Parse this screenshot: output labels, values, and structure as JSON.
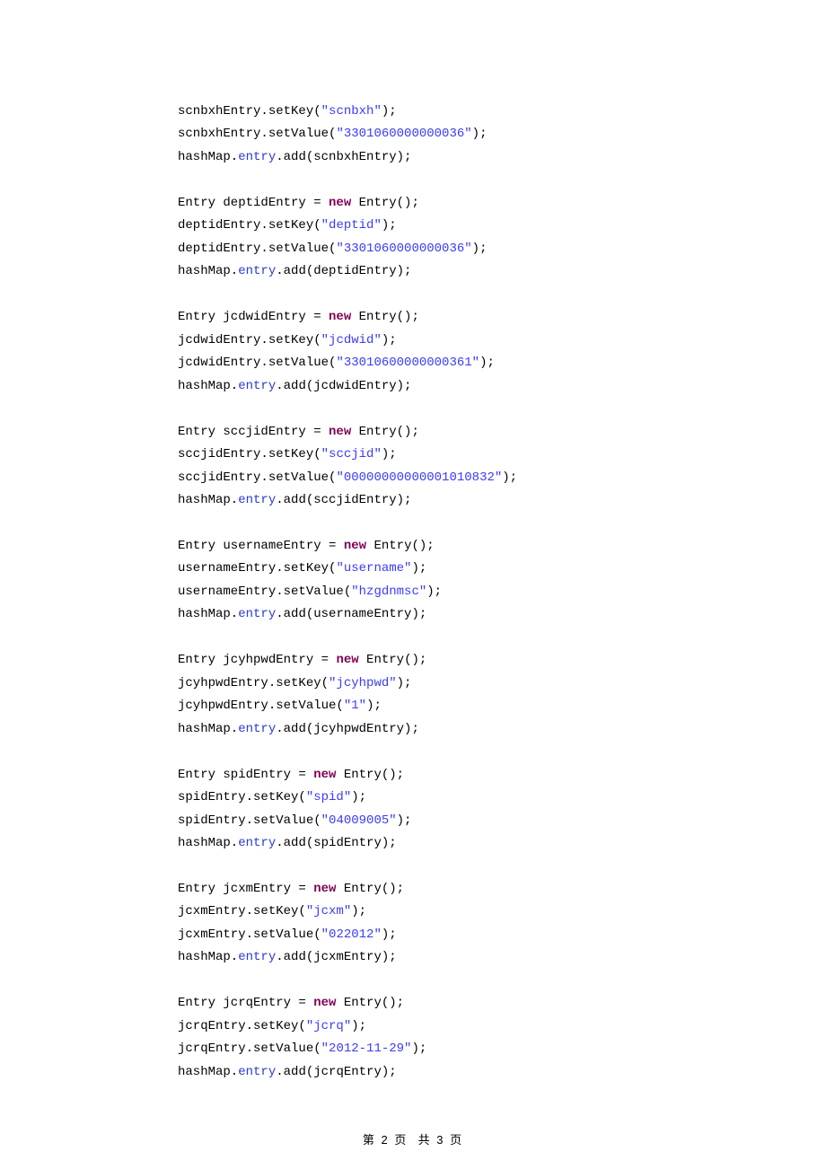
{
  "code": {
    "entries": [
      {
        "var": "scnbxhEntry",
        "key": "scnbxh",
        "value": "3301060000000036"
      },
      {
        "var": "deptidEntry",
        "key": "deptid",
        "value": "3301060000000036"
      },
      {
        "var": "jcdwidEntry",
        "key": "jcdwid",
        "value": "33010600000000361"
      },
      {
        "var": "sccjidEntry",
        "key": "sccjid",
        "value": "00000000000001010832"
      },
      {
        "var": "usernameEntry",
        "key": "username",
        "value": "hzgdnmsc"
      },
      {
        "var": "jcyhpwdEntry",
        "key": "jcyhpwd",
        "value": "1"
      },
      {
        "var": "spidEntry",
        "key": "spid",
        "value": "04009005"
      },
      {
        "var": "jcxmEntry",
        "key": "jcxm",
        "value": "022012"
      },
      {
        "var": "jcrqEntry",
        "key": "jcrq",
        "value": "2012-11-29"
      }
    ],
    "first_no_decl": true,
    "keyword_new": "new",
    "type_name": "Entry",
    "method_setKey": ".setKey(",
    "method_setValue": ".setValue(",
    "close_call": ");",
    "hashmap_prefix": "hashMap.",
    "entry_field": "entry",
    "add_open": ".add(",
    "decl_prefix": "Entry ",
    "equals": " = ",
    "ctor_tail": "();",
    "quote": "\""
  },
  "footer": {
    "prefix": "第",
    "page_current": "2",
    "mid1": "页",
    "sep": "共",
    "page_total": "3",
    "mid2": "页"
  }
}
